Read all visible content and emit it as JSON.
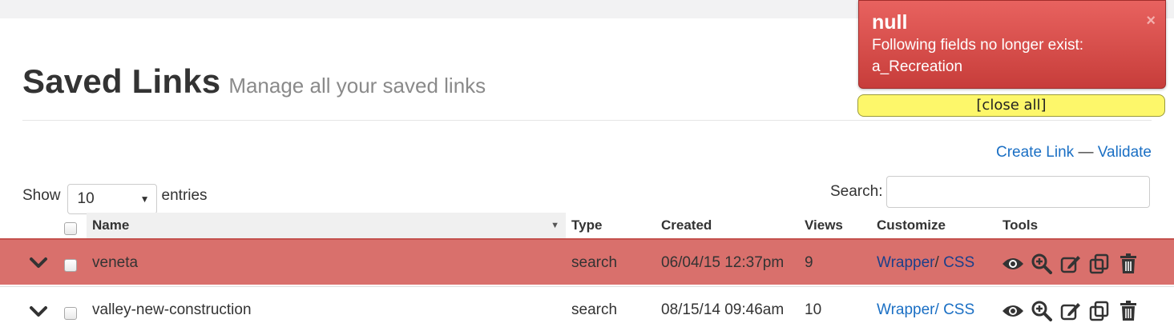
{
  "header": {
    "title": "Saved Links",
    "subtitle": "Manage all your saved links"
  },
  "actions": {
    "create_link": "Create Link",
    "separator": "—",
    "validate": "Validate"
  },
  "length_control": {
    "show_label": "Show",
    "selected": "10",
    "entries_label": "entries"
  },
  "search": {
    "label": "Search:",
    "value": "",
    "placeholder": ""
  },
  "table": {
    "columns": [
      "Name",
      "Type",
      "Created",
      "Views",
      "Customize",
      "Tools"
    ],
    "sorted_column": "Name",
    "rows": [
      {
        "name": "veneta",
        "type": "search",
        "created": "06/04/15 12:37pm",
        "views": "9",
        "wrapper": "Wrapper",
        "css": "CSS",
        "highlighted": true
      },
      {
        "name": "valley-new-construction",
        "type": "search",
        "created": "08/15/14 09:46am",
        "views": "10",
        "wrapper": "Wrapper",
        "css": "CSS",
        "highlighted": false
      }
    ],
    "tool_icons": [
      "eye-icon",
      "zoom-in-icon",
      "edit-icon",
      "copy-icon",
      "trash-icon"
    ]
  },
  "notification": {
    "title": "null",
    "message_line1": "Following fields no longer exist:",
    "message_line2": "a_Recreation",
    "close_glyph": "×",
    "close_all": "[close all]"
  },
  "colors": {
    "highlight_row": "#d9706c",
    "link": "#1a6fc4",
    "toast_bg": "#d94f4c",
    "close_all_bg": "#fdf76a"
  }
}
